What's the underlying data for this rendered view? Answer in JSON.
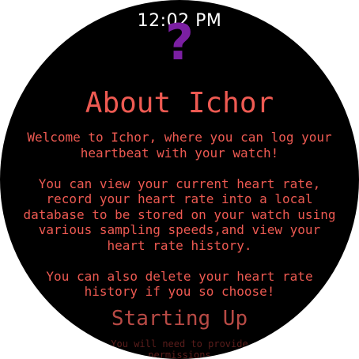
{
  "status_bar": {
    "time": "12:02 PM"
  },
  "header": {
    "icon": "question-mark-icon",
    "icon_glyph": "?",
    "icon_color": "#7b1fa2"
  },
  "about": {
    "title": "About Ichor",
    "paragraphs": [
      "Welcome to Ichor, where you can log your\nheartbeat with your watch!",
      "You can view your current heart rate,\nrecord your heart rate into a local\ndatabase to be stored on your watch using\nvarious sampling speeds,and view your\nheart rate history.",
      "You can also delete your heart rate\nhistory if you so choose!"
    ]
  },
  "starting_up": {
    "title": "Starting Up",
    "body": "You will need to provide\npermissions"
  },
  "colors": {
    "background": "#000000",
    "text_primary": "#ee5a52",
    "text_faded": "#b84a45",
    "accent_purple": "#7b1fa2"
  }
}
